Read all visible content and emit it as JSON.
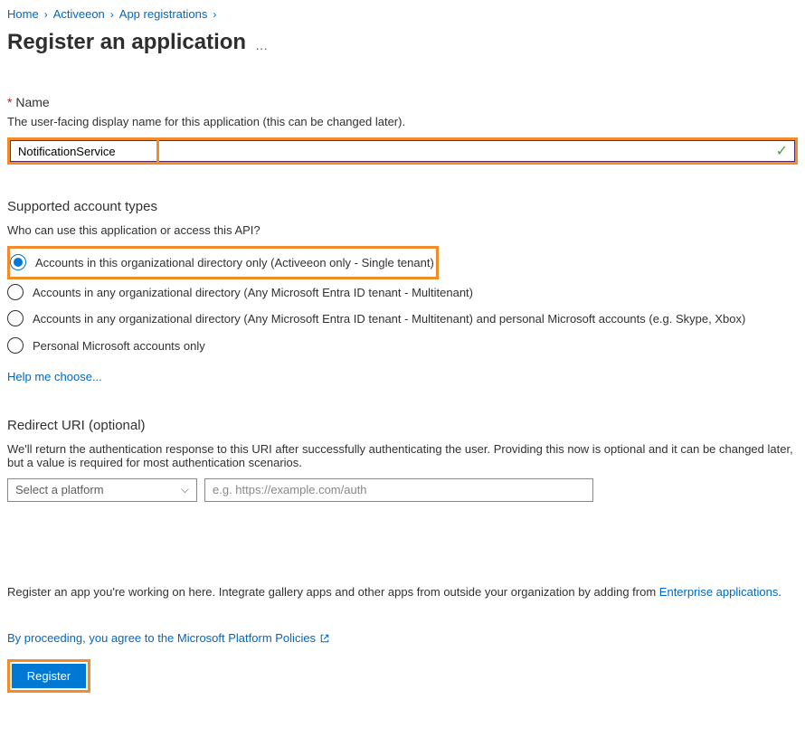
{
  "breadcrumb": {
    "items": [
      "Home",
      "Activeeon",
      "App registrations"
    ]
  },
  "page": {
    "title": "Register an application"
  },
  "name_section": {
    "label": "Name",
    "description": "The user-facing display name for this application (this can be changed later).",
    "value": "NotificationService"
  },
  "account_types": {
    "heading": "Supported account types",
    "question": "Who can use this application or access this API?",
    "options": [
      "Accounts in this organizational directory only (Activeeon only - Single tenant)",
      "Accounts in any organizational directory (Any Microsoft Entra ID tenant - Multitenant)",
      "Accounts in any organizational directory (Any Microsoft Entra ID tenant - Multitenant) and personal Microsoft accounts (e.g. Skype, Xbox)",
      "Personal Microsoft accounts only"
    ],
    "help_link": "Help me choose..."
  },
  "redirect": {
    "heading": "Redirect URI (optional)",
    "description": "We'll return the authentication response to this URI after successfully authenticating the user. Providing this now is optional and it can be changed later, but a value is required for most authentication scenarios.",
    "platform_placeholder": "Select a platform",
    "uri_placeholder": "e.g. https://example.com/auth"
  },
  "bottom": {
    "text_prefix": "Register an app you're working on here. Integrate gallery apps and other apps from outside your organization by adding from ",
    "link": "Enterprise applications",
    "text_suffix": "."
  },
  "consent": {
    "text": "By proceeding, you agree to the ",
    "link": "Microsoft Platform Policies"
  },
  "register_button": "Register"
}
